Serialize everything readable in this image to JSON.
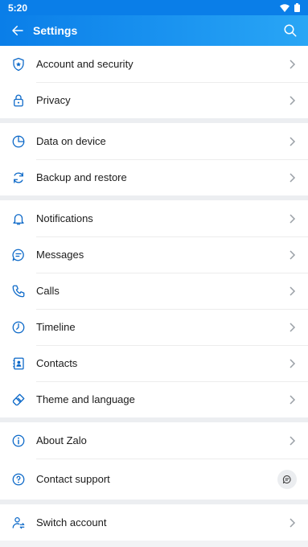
{
  "status": {
    "time": "5:20"
  },
  "header": {
    "title": "Settings"
  },
  "groups": [
    {
      "items": [
        {
          "label": "Account and security",
          "icon": "shield-icon"
        },
        {
          "label": "Privacy",
          "icon": "lock-icon"
        }
      ]
    },
    {
      "items": [
        {
          "label": "Data on device",
          "icon": "pie-chart-icon"
        },
        {
          "label": "Backup and restore",
          "icon": "sync-icon"
        }
      ]
    },
    {
      "items": [
        {
          "label": "Notifications",
          "icon": "bell-icon"
        },
        {
          "label": "Messages",
          "icon": "chat-icon"
        },
        {
          "label": "Calls",
          "icon": "phone-icon"
        },
        {
          "label": "Timeline",
          "icon": "clock-icon"
        },
        {
          "label": "Contacts",
          "icon": "contact-book-icon"
        },
        {
          "label": "Theme and language",
          "icon": "paintbrush-icon"
        }
      ]
    },
    {
      "items": [
        {
          "label": "About Zalo",
          "icon": "info-icon"
        },
        {
          "label": "Contact support",
          "icon": "help-icon"
        }
      ]
    },
    {
      "items": [
        {
          "label": "Switch account",
          "icon": "switch-account-icon"
        }
      ]
    }
  ],
  "colors": {
    "accent": "#0a7ee8",
    "icon": "#0b68c8",
    "chevron": "#9aa0a6"
  }
}
